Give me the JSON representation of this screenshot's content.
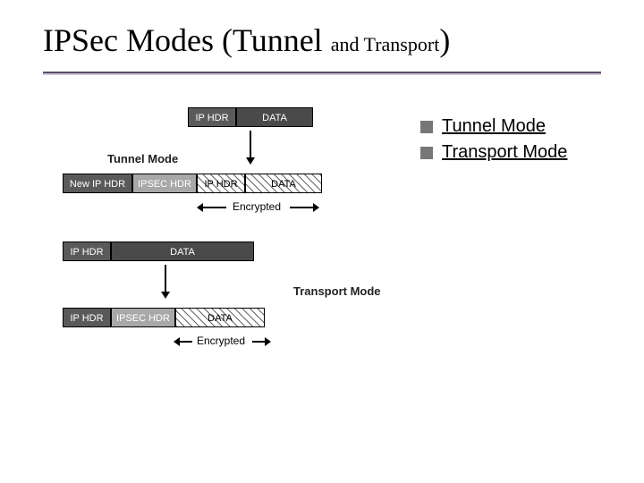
{
  "title_main": "IPSec Modes (Tunnel ",
  "title_sub": "and Transport",
  "title_tail": ")",
  "bullets": [
    {
      "label": "Tunnel Mode",
      "href": "#"
    },
    {
      "label": "Transport Mode",
      "href": "#"
    }
  ],
  "diagram": {
    "top_packet": {
      "ip_hdr": "IP HDR",
      "data": "DATA"
    },
    "tunnel_label": "Tunnel Mode",
    "tunnel_packet": {
      "new_ip_hdr": "New IP HDR",
      "ipsec_hdr": "IPSEC HDR",
      "ip_hdr": "IP HDR",
      "data": "DATA"
    },
    "encrypted_label": "Encrypted",
    "mid_packet": {
      "ip_hdr": "IP HDR",
      "data": "DATA"
    },
    "transport_label": "Transport Mode",
    "transport_packet": {
      "ip_hdr": "IP HDR",
      "ipsec_hdr": "IPSEC HDR",
      "data": "DATA"
    },
    "encrypted_label2": "Encrypted"
  }
}
